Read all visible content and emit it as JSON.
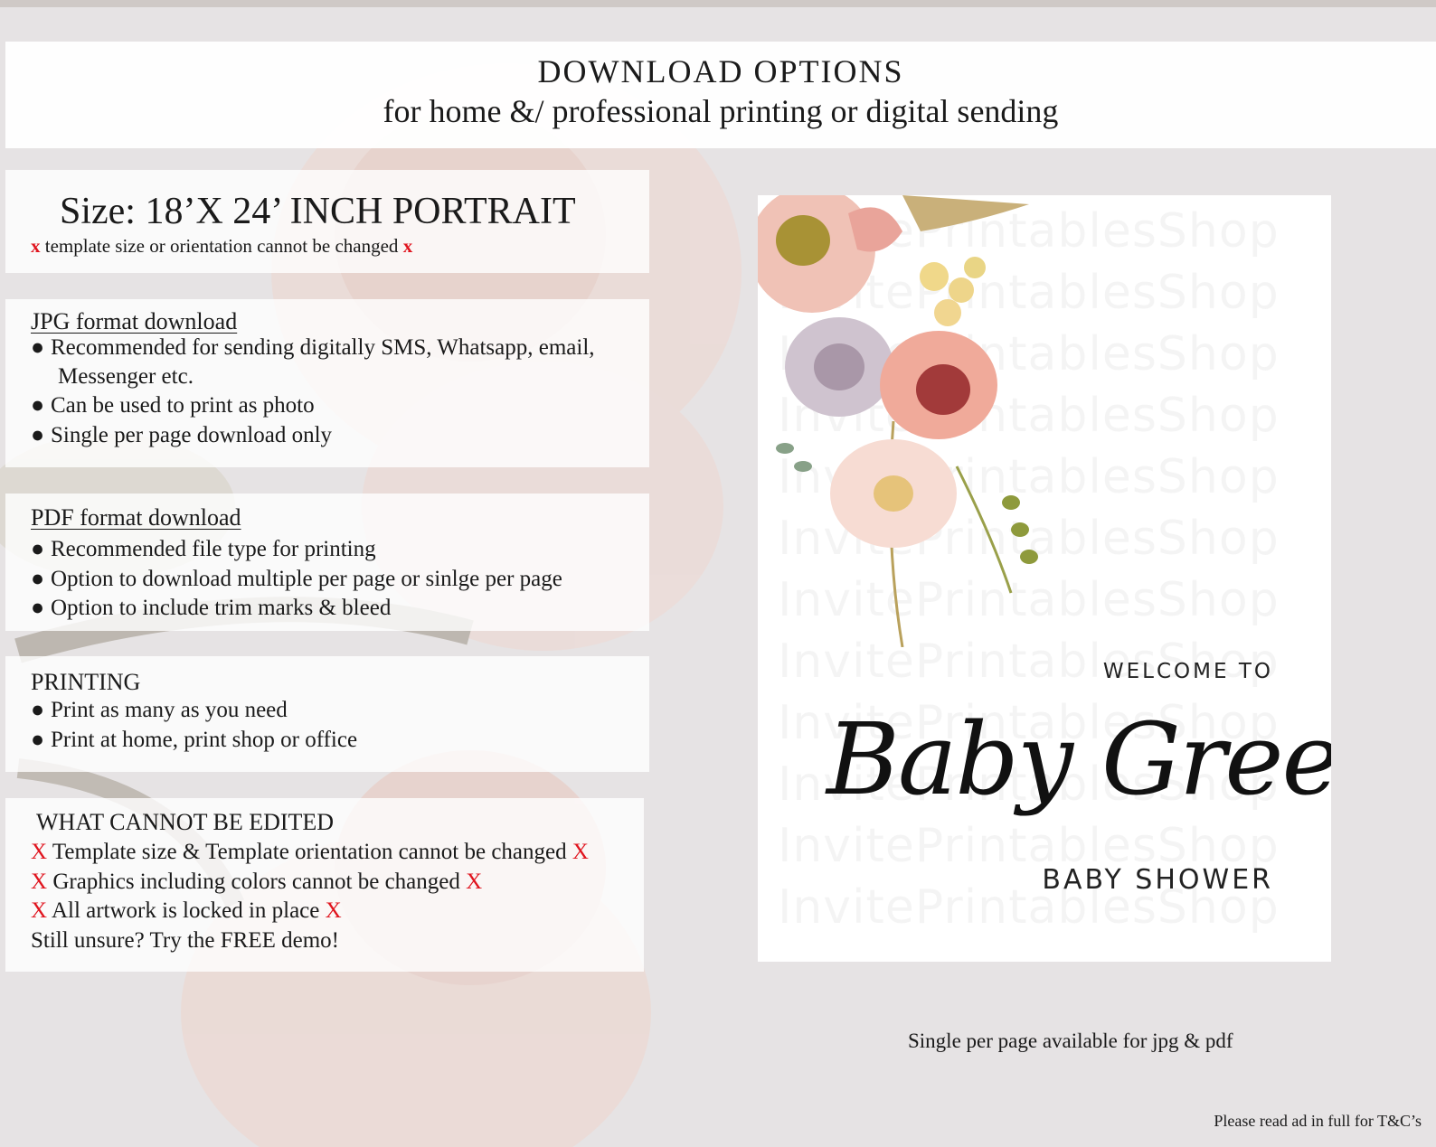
{
  "header": {
    "title": "DOWNLOAD OPTIONS",
    "subtitle": "for home &/ professional printing or digital sending"
  },
  "size": {
    "title": "Size: 18’X 24’ INCH PORTRAIT",
    "mark": "x",
    "note": "template size or orientation cannot be changed"
  },
  "jpg": {
    "title": "JPG format download",
    "bullet_1": "Recommended for sending digitally SMS, Whatsapp, email,",
    "bullet_1_cont": "Messenger etc.",
    "bullet_2": "Can be used to print as photo",
    "bullet_3": "Single per page download only"
  },
  "pdf": {
    "title": "PDF format download",
    "bullet_1": "Recommended file type for printing",
    "bullet_2": "Option to download multiple per page or sinlge per page",
    "bullet_3": "Option to include trim marks & bleed"
  },
  "printing": {
    "title": "PRINTING",
    "bullet_1": "Print as many as you need",
    "bullet_2": "Print at home, print shop or office"
  },
  "cannot_edit": {
    "title": "WHAT CANNOT BE EDITED",
    "mark": "X",
    "line_1": "Template size & Template orientation cannot be changed",
    "line_2": "Graphics including colors cannot be changed",
    "line_3": "All artwork is locked in place",
    "line_4": "Still unsure? Try the FREE demo!"
  },
  "preview": {
    "watermark": "InvitePrintablesShop",
    "welcome": "WELCOME TO",
    "name": "Baby Green’s",
    "event": "BABY SHOWER"
  },
  "caption": "Single per page available for jpg & pdf",
  "footer": "Please read ad in full for T&C’s",
  "colors": {
    "accent_red": "#e0141e",
    "background": "#e6e3e4"
  },
  "bullet_glyph": "●"
}
